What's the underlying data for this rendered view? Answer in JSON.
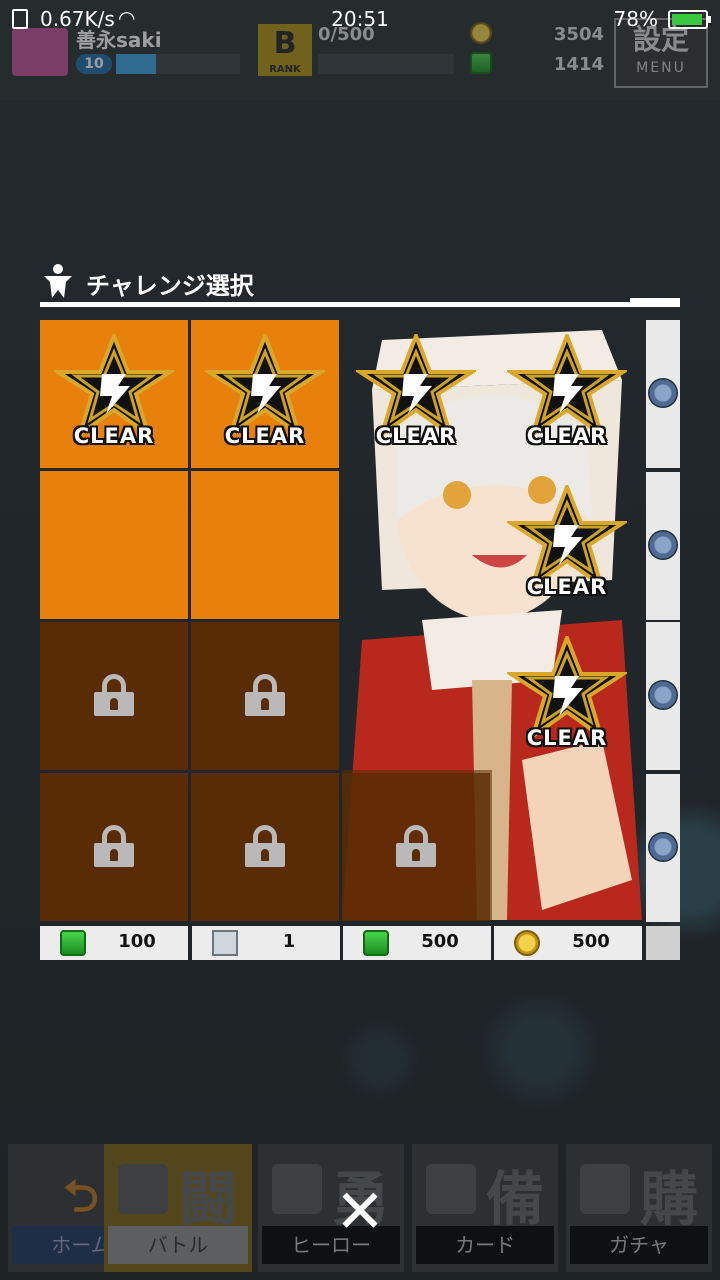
{
  "status_bar": {
    "network_speed": "0.67K/s",
    "time": "20:51",
    "battery": "78%"
  },
  "header": {
    "username": "善永saki",
    "level": "10",
    "level_progress": 0.3,
    "rank_letter": "B",
    "rank_label": "RANK",
    "exp": "0/500",
    "coins": "3504",
    "gems": "1414",
    "menu_kanji": "設定",
    "menu_label": "MENU"
  },
  "challenge": {
    "title": "チャレンジ選択",
    "clear_label": "CLEAR",
    "cells": [
      [
        "clear",
        "clear",
        "clear",
        "clear"
      ],
      [
        "open",
        "open",
        "open",
        "clear"
      ],
      [
        "locked",
        "locked",
        "open",
        "clear"
      ],
      [
        "locked",
        "locked",
        "locked",
        "open"
      ]
    ],
    "rewards": [
      {
        "icon": "gem-icon",
        "amount": "100"
      },
      {
        "icon": "ticket-icon",
        "amount": "1"
      },
      {
        "icon": "gem-icon",
        "amount": "500"
      },
      {
        "icon": "coin-icon",
        "amount": "500"
      }
    ]
  },
  "bottom_nav": {
    "items": [
      {
        "kanji": "",
        "label": "ホーム"
      },
      {
        "kanji": "闘",
        "label": "バトル"
      },
      {
        "kanji": "勇",
        "label": "ヒーロー"
      },
      {
        "kanji": "備",
        "label": "カード"
      },
      {
        "kanji": "購",
        "label": "ガチャ"
      }
    ],
    "close_symbol": "✕"
  },
  "colors": {
    "open_cell": "#e8800c",
    "locked_cell": "#5a2c06",
    "accent_gold": "#c9a227"
  }
}
